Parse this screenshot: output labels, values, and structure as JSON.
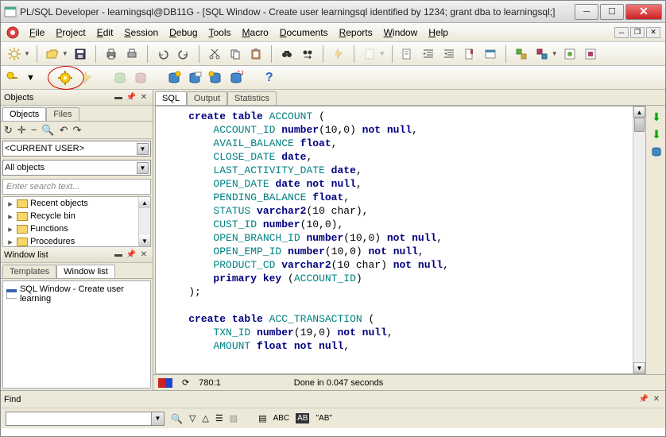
{
  "title": "PL/SQL Developer - learningsql@DB11G - [SQL Window - Create user learningsql identified by 1234; grant dba to learningsql;]",
  "menus": [
    "File",
    "Project",
    "Edit",
    "Session",
    "Debug",
    "Tools",
    "Macro",
    "Documents",
    "Reports",
    "Window",
    "Help"
  ],
  "objects_header": "Objects",
  "objects_tabs": [
    "Objects",
    "Files"
  ],
  "current_user": "<CURRENT USER>",
  "filter": "All objects",
  "search_placeholder": "Enter search text...",
  "tree_items": [
    "Recent objects",
    "Recycle bin",
    "Functions",
    "Procedures"
  ],
  "windowlist_header": "Window list",
  "windowlist_tabs": [
    "Templates",
    "Window list"
  ],
  "windowlist_item": "SQL Window - Create user learning",
  "sql_tabs": [
    "SQL",
    "Output",
    "Statistics"
  ],
  "status": {
    "pos": "780:1",
    "msg": "Done in 0.047 seconds"
  },
  "find_label": "Find",
  "find_ab": "\"AB\"",
  "code": [
    {
      "i": 2,
      "t": "kw",
      "s": "create table"
    },
    {
      "i": 0,
      "t": "plain",
      "s": " "
    },
    {
      "i": 0,
      "t": "ident",
      "s": "ACCOUNT"
    },
    {
      "i": 0,
      "t": "plain",
      "s": " ("
    },
    {
      "nl": 1
    },
    {
      "i": 4,
      "t": "ident",
      "s": "ACCOUNT_ID"
    },
    {
      "i": 0,
      "t": "plain",
      "s": " "
    },
    {
      "i": 0,
      "t": "kw",
      "s": "number"
    },
    {
      "i": 0,
      "t": "plain",
      "s": "(10,0) "
    },
    {
      "i": 0,
      "t": "kw",
      "s": "not null"
    },
    {
      "i": 0,
      "t": "plain",
      "s": ","
    },
    {
      "nl": 1
    },
    {
      "i": 4,
      "t": "ident",
      "s": "AVAIL_BALANCE"
    },
    {
      "i": 0,
      "t": "plain",
      "s": " "
    },
    {
      "i": 0,
      "t": "kw",
      "s": "float"
    },
    {
      "i": 0,
      "t": "plain",
      "s": ","
    },
    {
      "nl": 1
    },
    {
      "i": 4,
      "t": "ident",
      "s": "CLOSE_DATE"
    },
    {
      "i": 0,
      "t": "plain",
      "s": " "
    },
    {
      "i": 0,
      "t": "kw",
      "s": "date"
    },
    {
      "i": 0,
      "t": "plain",
      "s": ","
    },
    {
      "nl": 1
    },
    {
      "i": 4,
      "t": "ident",
      "s": "LAST_ACTIVITY_DATE"
    },
    {
      "i": 0,
      "t": "plain",
      "s": " "
    },
    {
      "i": 0,
      "t": "kw",
      "s": "date"
    },
    {
      "i": 0,
      "t": "plain",
      "s": ","
    },
    {
      "nl": 1
    },
    {
      "i": 4,
      "t": "ident",
      "s": "OPEN_DATE"
    },
    {
      "i": 0,
      "t": "plain",
      "s": " "
    },
    {
      "i": 0,
      "t": "kw",
      "s": "date not null"
    },
    {
      "i": 0,
      "t": "plain",
      "s": ","
    },
    {
      "nl": 1
    },
    {
      "i": 4,
      "t": "ident",
      "s": "PENDING_BALANCE"
    },
    {
      "i": 0,
      "t": "plain",
      "s": " "
    },
    {
      "i": 0,
      "t": "kw",
      "s": "float"
    },
    {
      "i": 0,
      "t": "plain",
      "s": ","
    },
    {
      "nl": 1
    },
    {
      "i": 4,
      "t": "ident",
      "s": "STATUS"
    },
    {
      "i": 0,
      "t": "plain",
      "s": " "
    },
    {
      "i": 0,
      "t": "kw",
      "s": "varchar2"
    },
    {
      "i": 0,
      "t": "plain",
      "s": "(10 char),"
    },
    {
      "nl": 1
    },
    {
      "i": 4,
      "t": "ident",
      "s": "CUST_ID"
    },
    {
      "i": 0,
      "t": "plain",
      "s": " "
    },
    {
      "i": 0,
      "t": "kw",
      "s": "number"
    },
    {
      "i": 0,
      "t": "plain",
      "s": "(10,0),"
    },
    {
      "nl": 1
    },
    {
      "i": 4,
      "t": "ident",
      "s": "OPEN_BRANCH_ID"
    },
    {
      "i": 0,
      "t": "plain",
      "s": " "
    },
    {
      "i": 0,
      "t": "kw",
      "s": "number"
    },
    {
      "i": 0,
      "t": "plain",
      "s": "(10,0) "
    },
    {
      "i": 0,
      "t": "kw",
      "s": "not null"
    },
    {
      "i": 0,
      "t": "plain",
      "s": ","
    },
    {
      "nl": 1
    },
    {
      "i": 4,
      "t": "ident",
      "s": "OPEN_EMP_ID"
    },
    {
      "i": 0,
      "t": "plain",
      "s": " "
    },
    {
      "i": 0,
      "t": "kw",
      "s": "number"
    },
    {
      "i": 0,
      "t": "plain",
      "s": "(10,0) "
    },
    {
      "i": 0,
      "t": "kw",
      "s": "not null"
    },
    {
      "i": 0,
      "t": "plain",
      "s": ","
    },
    {
      "nl": 1
    },
    {
      "i": 4,
      "t": "ident",
      "s": "PRODUCT_CD"
    },
    {
      "i": 0,
      "t": "plain",
      "s": " "
    },
    {
      "i": 0,
      "t": "kw",
      "s": "varchar2"
    },
    {
      "i": 0,
      "t": "plain",
      "s": "(10 char) "
    },
    {
      "i": 0,
      "t": "kw",
      "s": "not null"
    },
    {
      "i": 0,
      "t": "plain",
      "s": ","
    },
    {
      "nl": 1
    },
    {
      "i": 4,
      "t": "kw",
      "s": "primary key"
    },
    {
      "i": 0,
      "t": "plain",
      "s": " ("
    },
    {
      "i": 0,
      "t": "ident",
      "s": "ACCOUNT_ID"
    },
    {
      "i": 0,
      "t": "plain",
      "s": ")"
    },
    {
      "nl": 1
    },
    {
      "i": 2,
      "t": "plain",
      "s": ");"
    },
    {
      "nl": 1
    },
    {
      "nl": 1
    },
    {
      "i": 2,
      "t": "kw",
      "s": "create table"
    },
    {
      "i": 0,
      "t": "plain",
      "s": " "
    },
    {
      "i": 0,
      "t": "ident",
      "s": "ACC_TRANSACTION"
    },
    {
      "i": 0,
      "t": "plain",
      "s": " ("
    },
    {
      "nl": 1
    },
    {
      "i": 4,
      "t": "ident",
      "s": "TXN_ID"
    },
    {
      "i": 0,
      "t": "plain",
      "s": " "
    },
    {
      "i": 0,
      "t": "kw",
      "s": "number"
    },
    {
      "i": 0,
      "t": "plain",
      "s": "(19,0) "
    },
    {
      "i": 0,
      "t": "kw",
      "s": "not null"
    },
    {
      "i": 0,
      "t": "plain",
      "s": ","
    },
    {
      "nl": 1
    },
    {
      "i": 4,
      "t": "ident",
      "s": "AMOUNT"
    },
    {
      "i": 0,
      "t": "plain",
      "s": " "
    },
    {
      "i": 0,
      "t": "kw",
      "s": "float not null"
    },
    {
      "i": 0,
      "t": "plain",
      "s": ","
    },
    {
      "nl": 1
    }
  ]
}
